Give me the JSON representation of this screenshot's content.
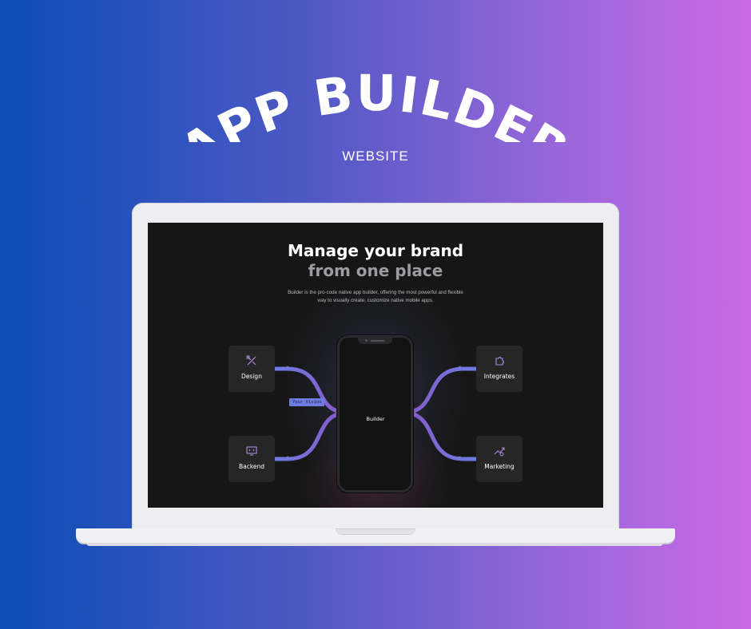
{
  "poster": {
    "title": "APP BUILDER",
    "subtitle": "WEBSITE"
  },
  "screen": {
    "headline_line1": "Manage your brand",
    "headline_line2": "from one place",
    "description_line1": "Builder is the pro-code native app builder, offering the most powerful and flexible",
    "description_line2": "way to visually create, customize native mobile apps.",
    "center_label": "Builder",
    "vision_tag": "Your Vision",
    "nodes": {
      "design": {
        "label": "Design",
        "icon": "design-tools-icon"
      },
      "backend": {
        "label": "Backend",
        "icon": "monitor-code-icon"
      },
      "integrates": {
        "label": "Integrates",
        "icon": "puzzle-icon"
      },
      "marketing": {
        "label": "Marketing",
        "icon": "growth-chart-icon"
      }
    }
  },
  "colors": {
    "background_left": "#0a4db4",
    "background_right": "#cc69e6",
    "screen_bg": "#161616",
    "accent_blue": "#6d7ce0",
    "accent_purple": "#8d5ac8"
  }
}
